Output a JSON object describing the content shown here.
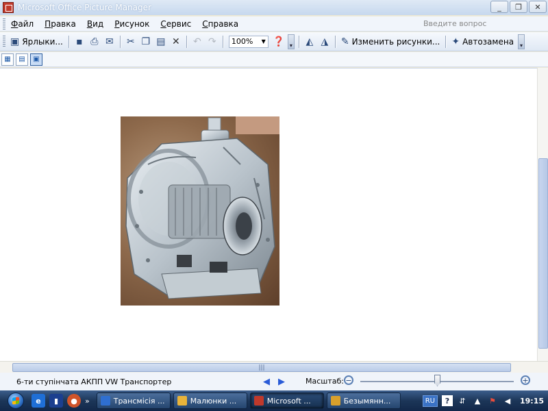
{
  "window": {
    "title": "Microsoft Office Picture Manager",
    "minimize": "_",
    "restore": "❐",
    "close": "✕"
  },
  "menu": {
    "items": [
      "Файл",
      "Правка",
      "Вид",
      "Рисунок",
      "Сервис",
      "Справка"
    ],
    "help_placeholder": "Введите вопрос"
  },
  "toolbar": {
    "shortcuts_label": "Ярлыки...",
    "zoom_value": "100%",
    "edit_pictures_label": "Изменить рисунки...",
    "autocorrect_label": "Автозамена"
  },
  "status": {
    "filename": "6-ти ступінчата АКПП VW Транспортер",
    "zoom_label": "Масштаб:"
  },
  "taskbar": {
    "items": [
      {
        "label": "Трансмісія ...",
        "color": "#2f6fd1"
      },
      {
        "label": "Малюнки ...",
        "color": "#e8b33a"
      },
      {
        "label": "Microsoft ...",
        "color": "#c0392b"
      },
      {
        "label": "Безымянн...",
        "color": "#d9a02b"
      }
    ],
    "lang": "RU",
    "clock": "19:15"
  }
}
